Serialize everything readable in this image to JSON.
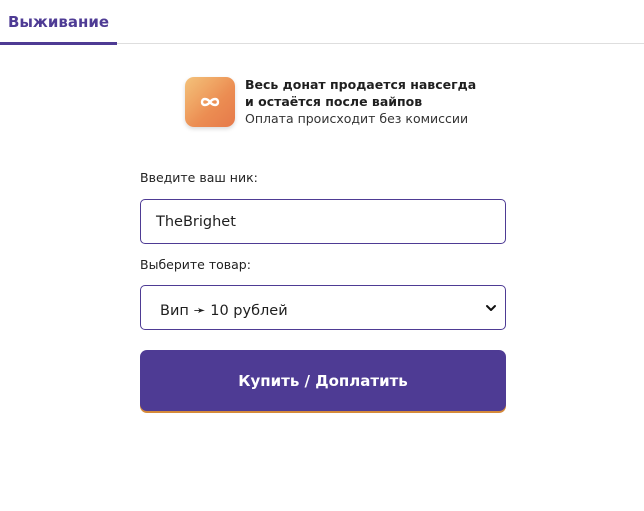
{
  "tabs": [
    {
      "label": "Выживание",
      "active": true
    }
  ],
  "info": {
    "icon": "infinity-icon",
    "title_line1": "Весь донат продается навсегда",
    "title_line2": "и остаётся после вайпов",
    "subtitle": "Оплата происходит без комиссии"
  },
  "form": {
    "nick_label": "Введите ваш ник:",
    "nick_value": "TheBrighet",
    "product_label": "Выберите товар:",
    "product_selected": "Вип ➛ 10 рублей",
    "submit_label": "Купить / Доплатить"
  },
  "colors": {
    "accent": "#4e3b94",
    "icon_gradient_start": "#f2b866",
    "icon_gradient_end": "#e6794a",
    "button_bottom_border": "#d58a3a"
  }
}
